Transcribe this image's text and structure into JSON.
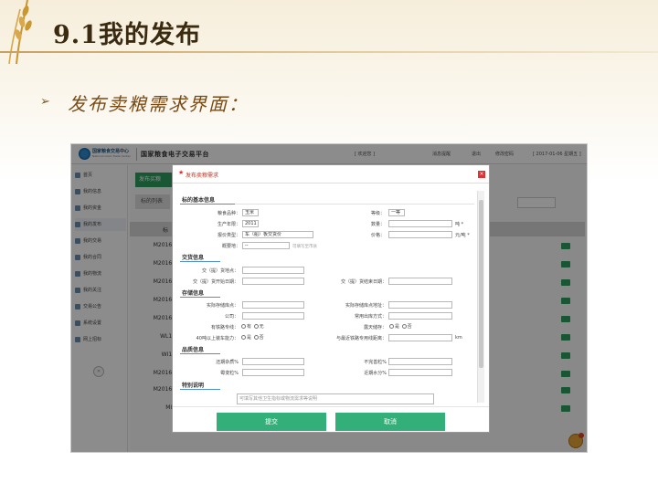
{
  "slide": {
    "title": "9.1我的发布",
    "bullet": "➢",
    "subtitle": "发布卖粮需求界面："
  },
  "topbar": {
    "logo_text": "国家粮食交易中心",
    "logo_sub": "National Grain Trade Center",
    "platform": "国家粮食电子交易平台",
    "links": [
      "[ 欢迎您 ]",
      "消息提醒",
      "退出",
      "修改密码",
      "[ 2017-01-06 星期五 ]"
    ]
  },
  "sidebar": {
    "items": [
      "首页",
      "我的信息",
      "我的资金",
      "我的发布",
      "我的交易",
      "我的合同",
      "我的物流",
      "我的关注",
      "交易公告",
      "系统设置",
      "网上招标"
    ],
    "active_index": 3,
    "collapse_glyph": "«"
  },
  "main": {
    "tab_publish": "发布买粮",
    "tab_list": "标的列表",
    "list_head": "标",
    "query_button": "查询",
    "rows": [
      "M20161",
      "M20161",
      "M20161",
      "M20165",
      "M20168",
      "WL15",
      "WI15",
      "M20161",
      "M20161",
      "MI1"
    ]
  },
  "modal": {
    "title": "发布卖粮需求",
    "star": "★",
    "close": "×",
    "sections": {
      "basic": "标的基本信息",
      "delivery": "交货信息",
      "storage": "存储信息",
      "quality": "品质信息",
      "special": "特别说明"
    },
    "basic": {
      "variety_label": "粮食品种：",
      "variety_value": "玉米",
      "grade_label": "等级：",
      "grade_value": "一等",
      "year_label": "生产年限：",
      "year_value": "2011",
      "qty_label": "数量：",
      "qty_unit": "吨 *",
      "price_type_label": "报价类型：",
      "price_type_value": "车（船）板交货价",
      "price_label": "价格：",
      "price_unit": "元/吨 *",
      "remark_label": "概要地：",
      "remark_value": "--",
      "remark_hint": "可填写至市县"
    },
    "delivery": {
      "place_label": "交（提）货地点：",
      "start_label": "交（提）货开始日期：",
      "end_label": "交（提）货结束日期："
    },
    "storage": {
      "warehouse_label": "实际存储库点：",
      "warehouse_addr_label": "实际存储库点地址：",
      "company_label": "公司：",
      "outbound_label": "常用出库方式：",
      "rail_label": "有铁路专线：",
      "rail_yes": "有",
      "rail_no": "无",
      "shelter_label": "露天储存：",
      "shelter_yes": "是",
      "shelter_no": "否",
      "capacity_label": "40吨以上装车能力：",
      "capacity_yes": "是",
      "capacity_no": "否",
      "distance_label": "与最近铁路专用线距离：",
      "distance_unit": "km"
    },
    "quality": {
      "impurity_label": "还期杂质%",
      "imperfect_label": "不完善粒%",
      "mildew_label": "霉变粒%",
      "moisture_label": "近期水分%"
    },
    "special_hint": "可填写其他卫生指标或物流需求等说明",
    "submit": "提交",
    "cancel": "取消"
  },
  "colors": {
    "accent_green": "#33b07a",
    "title_red": "#bb3322",
    "dark_green": "#2e5a3e"
  }
}
